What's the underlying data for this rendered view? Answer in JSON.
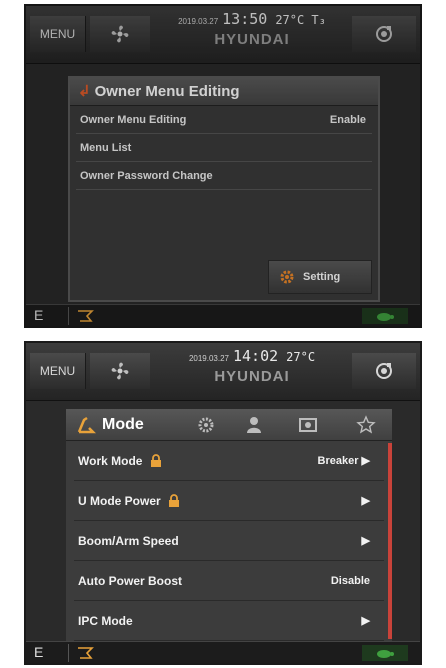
{
  "screen1": {
    "topbar": {
      "menu_label": "MENU",
      "date": "2019.03.27",
      "time": "13:50",
      "temp": "27°C T₃",
      "brand": "HYUNDAI"
    },
    "dialog": {
      "title": "Owner Menu Editing",
      "rows": [
        {
          "label": "Owner Menu Editing",
          "value": "Enable"
        },
        {
          "label": "Menu List",
          "value": ""
        },
        {
          "label": "Owner Password Change",
          "value": ""
        }
      ],
      "setting_label": "Setting"
    },
    "bottombar": {
      "mode_letter": "E"
    }
  },
  "screen2": {
    "topbar": {
      "menu_label": "MENU",
      "date": "2019.03.27",
      "time": "14:02",
      "temp": "27°C",
      "brand": "HYUNDAI"
    },
    "panel": {
      "title": "Mode",
      "tab_icons": [
        "mode-icon",
        "gear-gauge-icon",
        "user-icon",
        "display-icon",
        "star-icon"
      ],
      "rows": [
        {
          "label": "Work Mode",
          "locked": true,
          "value": "Breaker ▶"
        },
        {
          "label": "U Mode Power",
          "locked": true,
          "value": "▶"
        },
        {
          "label": "Boom/Arm Speed",
          "locked": false,
          "value": "▶"
        },
        {
          "label": "Auto Power Boost",
          "locked": false,
          "value": "Disable"
        },
        {
          "label": "IPC Mode",
          "locked": false,
          "value": "▶"
        }
      ]
    },
    "bottombar": {
      "mode_letter": "E"
    }
  },
  "colors": {
    "accent": "#e25b2a",
    "lock": "#e8a23a",
    "scrollbar": "#c9433a",
    "turtle": "#3fa03f"
  }
}
